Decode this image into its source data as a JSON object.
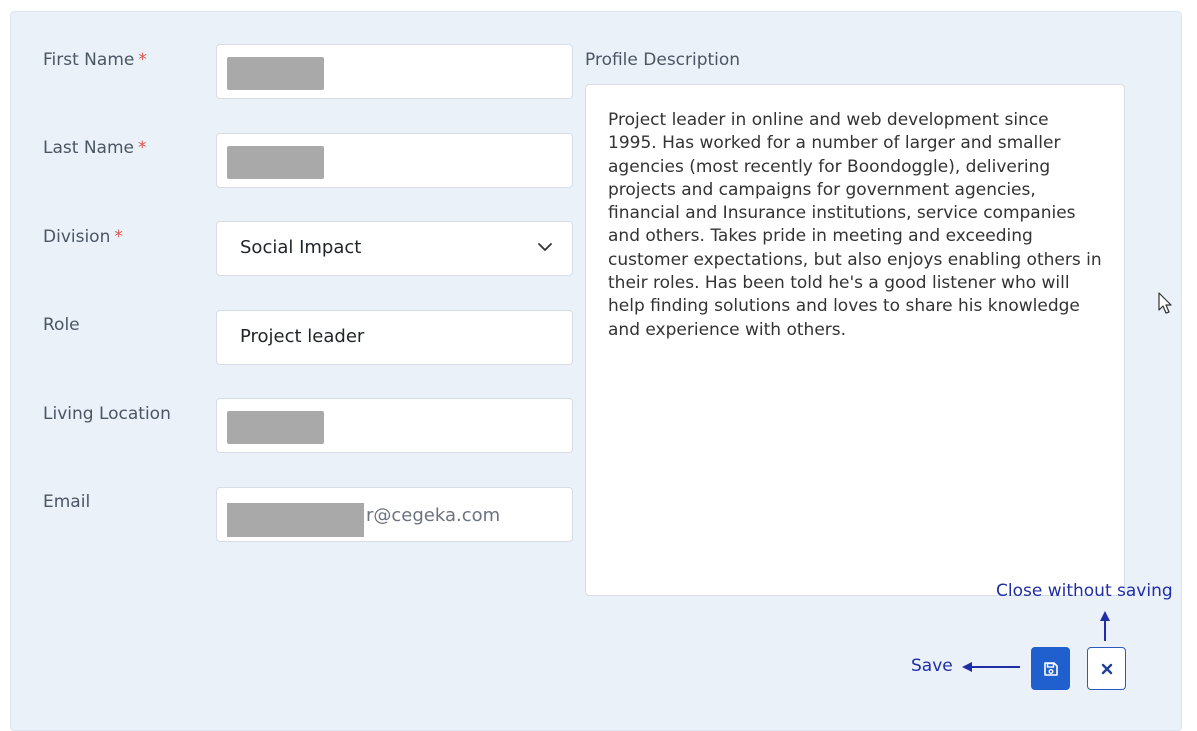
{
  "form": {
    "first_name_label": "First Name",
    "last_name_label": "Last Name",
    "division_label": "Division",
    "role_label": "Role",
    "living_location_label": "Living Location",
    "email_label": "Email",
    "required_mark": "*",
    "division_value": "Social Impact",
    "role_value": "Project leader",
    "email_visible_suffix": "r@cegeka.com"
  },
  "description": {
    "label": "Profile Description",
    "text": "Project leader in online and web development since 1995. Has worked for a number of larger and smaller agencies (most recently for Boondoggle), delivering projects  and campaigns for government agencies, financial and Insurance institutions, service companies and others. Takes pride in meeting and exceeding customer expectations, but also enjoys enabling others in their roles. Has been told he's a good listener who will help finding solutions and loves to share his knowledge and experience with others."
  },
  "annotations": {
    "save": "Save",
    "close": "Close without saving"
  },
  "icons": {
    "save": "floppy-disk-icon",
    "close": "x-icon",
    "chevron": "chevron-down-icon",
    "cursor": "mouse-pointer-icon"
  },
  "colors": {
    "panel_bg": "#eaf1f9",
    "save_button_bg": "#1f5fce",
    "annotation": "#1f2ea7",
    "required": "#d9534f"
  }
}
